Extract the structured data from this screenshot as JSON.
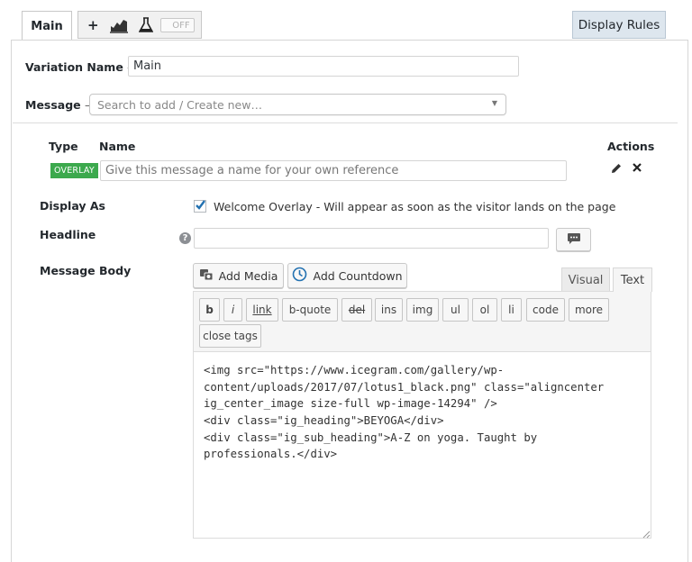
{
  "tabs": {
    "main_label": "Main",
    "plus_label": "+",
    "toggle_label": "OFF",
    "display_rules_label": "Display Rules"
  },
  "variation": {
    "label": "Variation Name",
    "value": "Main"
  },
  "message_select": {
    "label": "Message",
    "placeholder": "Search to add / Create new…"
  },
  "table": {
    "col_type": "Type",
    "col_name": "Name",
    "col_actions": "Actions",
    "row": {
      "type_badge": "OVERLAY",
      "name_placeholder": "Give this message a name for your own reference"
    }
  },
  "display_as": {
    "label": "Display As",
    "checkbox_label": "Welcome Overlay - Will appear as soon as the visitor lands on the page",
    "checked": true
  },
  "headline": {
    "label": "Headline",
    "help_glyph": "?",
    "value": ""
  },
  "message_body": {
    "label": "Message Body",
    "add_media_label": "Add Media",
    "add_countdown_label": "Add Countdown",
    "tab_visual": "Visual",
    "tab_text": "Text",
    "quicktags": [
      "b",
      "i",
      "link",
      "b-quote",
      "del",
      "ins",
      "img",
      "ul",
      "ol",
      "li",
      "code",
      "more"
    ],
    "close_tags": "close tags",
    "code_lines": [
      "<img src=\"https://www.icegram.com/gallery/wp-",
      "content/uploads/2017/07/lotus1_black.png\" class=\"aligncenter",
      "ig_center_image size-full wp-image-14294\" />",
      "<div class=\"ig_heading\">BEYOGA</div>",
      "<div class=\"ig_sub_heading\">A-Z on yoga. Taught by",
      "professionals.</div>"
    ]
  },
  "colors": {
    "badge_green": "#3ca94d",
    "checkbox_blue": "#2271b1",
    "rules_tab_bg": "#dde6ee"
  }
}
